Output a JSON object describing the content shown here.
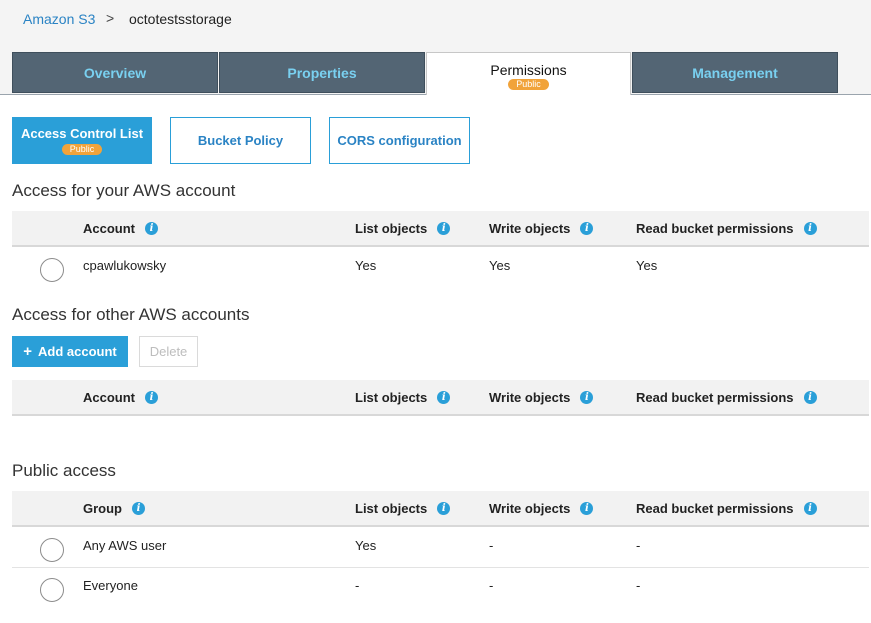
{
  "breadcrumb": {
    "root": "Amazon S3",
    "separator": ">",
    "current": "octotestsstorage"
  },
  "tabs": [
    {
      "label": "Overview"
    },
    {
      "label": "Properties"
    },
    {
      "label": "Permissions",
      "badge": "Public"
    },
    {
      "label": "Management"
    }
  ],
  "subtabs": [
    {
      "label": "Access Control List",
      "badge": "Public"
    },
    {
      "label": "Bucket Policy"
    },
    {
      "label": "CORS configuration"
    }
  ],
  "section_own": {
    "title": "Access for your AWS account",
    "headers": [
      "Account",
      "List objects",
      "Write objects",
      "Read bucket permissions"
    ],
    "rows": [
      {
        "name": "cpawlukowsky",
        "list": "Yes",
        "write": "Yes",
        "read": "Yes"
      }
    ]
  },
  "section_other": {
    "title": "Access for other AWS accounts",
    "add_label": "Add account",
    "delete_label": "Delete",
    "headers": [
      "Account",
      "List objects",
      "Write objects",
      "Read bucket permissions"
    ]
  },
  "section_public": {
    "title": "Public access",
    "headers": [
      "Group",
      "List objects",
      "Write objects",
      "Read bucket permissions"
    ],
    "rows": [
      {
        "name": "Any AWS user",
        "list": "Yes",
        "write": "-",
        "read": "-"
      },
      {
        "name": "Everyone",
        "list": "-",
        "write": "-",
        "read": "-"
      }
    ]
  },
  "icons": {
    "info": "info-icon",
    "plus": "plus-icon",
    "chevron": "chevron-right-icon"
  },
  "colors": {
    "accent": "#2a9fd8",
    "tab_bg": "#536574",
    "tab_text": "#79d0f0",
    "badge": "#f1a33a"
  }
}
